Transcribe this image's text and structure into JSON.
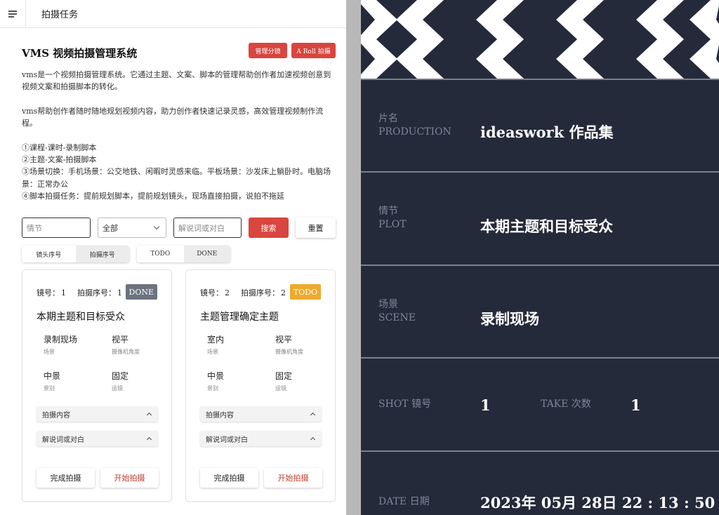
{
  "topbar": {
    "title": "拍摄任务"
  },
  "header": {
    "app_title": "VMS 视频拍摄管理系统",
    "manage_btn": "管理分镜",
    "aroll_btn": "A Roll 拍摄"
  },
  "description": {
    "p1": "vms是一个视频拍摄管理系统。它通过主题、文案、脚本的管理帮助创作者加速视频创意到视频文案和拍摄脚本的转化。",
    "p2": "vms帮助创作者随时随地规划视频内容，助力创作者快速记录灵感，高效管理视频制作流程。",
    "list": [
      "①课程-课时-录制脚本",
      "②主题-文案-拍摄脚本",
      "③场景切换：手机场景：公交地铁、闲暇时灵感来临。平板场景：沙发床上躺卧时。电脑场景：正常办公",
      "④脚本拍摄任务：提前规划脚本，提前规划镜头，现场直接拍摄，说拍不拖延"
    ]
  },
  "filters": {
    "plot_placeholder": "情节",
    "select_value": "全部",
    "narration_placeholder": "解说词或对白",
    "search_btn": "搜索",
    "reset_btn": "重置"
  },
  "sort_toggle": [
    "镜头序号",
    "拍摄序号"
  ],
  "status_toggle": [
    "TODO",
    "DONE"
  ],
  "cards": [
    {
      "shot_label": "镜号：",
      "shot_no": "1",
      "seq_label": "拍摄序号：",
      "seq_no": "1",
      "status": "DONE",
      "title": "本期主题和目标受众",
      "scene_value": "录制现场",
      "scene_key": "场景",
      "angle_value": "视平",
      "angle_key": "摄像机角度",
      "size_value": "中景",
      "size_key": "景别",
      "move_value": "固定",
      "move_key": "运镜",
      "content_label": "拍摄内容",
      "narration_label": "解说词或对白",
      "complete_btn": "完成拍摄",
      "start_btn": "开始拍摄"
    },
    {
      "shot_label": "镜号：",
      "shot_no": "2",
      "seq_label": "拍摄序号：",
      "seq_no": "2",
      "status": "TODO",
      "title": "主题管理确定主题",
      "scene_value": "室内",
      "scene_key": "场景",
      "angle_value": "视平",
      "angle_key": "摄像机角度",
      "size_value": "中景",
      "size_key": "景别",
      "move_value": "固定",
      "move_key": "运镜",
      "content_label": "拍摄内容",
      "narration_label": "解说词或对白",
      "complete_btn": "完成拍摄",
      "start_btn": "开始拍摄"
    }
  ],
  "slate": {
    "production_cn": "片名",
    "production_en": "PRODUCTION",
    "production_value": "ideaswork 作品集",
    "plot_cn": "情节",
    "plot_en": "PLOT",
    "plot_value": "本期主题和目标受众",
    "scene_cn": "场景",
    "scene_en": "SCENE",
    "scene_value": "录制现场",
    "shot_label": "SHOT 镜号",
    "shot_value": "1",
    "take_label": "TAKE 次数",
    "take_value": "1",
    "date_label": "DATE 日期",
    "date_value": "2023年 05月 28日 22 : 13 : 50"
  },
  "colors": {
    "accent_red": "#d9453f",
    "done_badge": "#6b7280",
    "todo_badge": "#f0a92e",
    "slate_bg": "#242a3a"
  }
}
